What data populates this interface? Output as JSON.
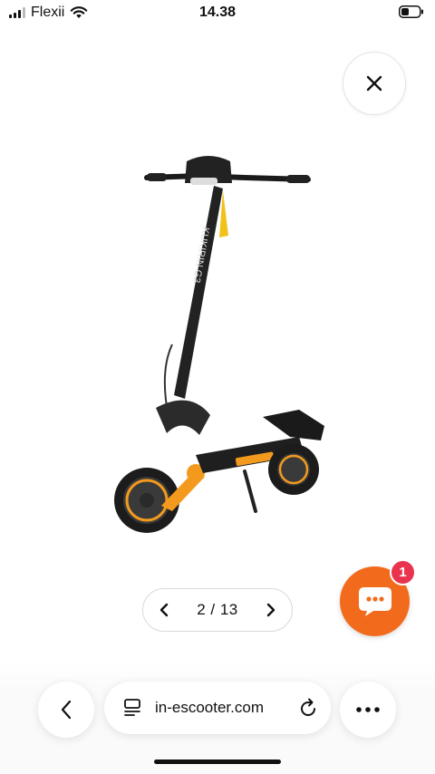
{
  "status_bar": {
    "carrier": "Flexii",
    "time": "14.38"
  },
  "gallery": {
    "current": "2",
    "total": "13",
    "pager_text": "2 / 13"
  },
  "chat": {
    "badge_count": "1"
  },
  "browser": {
    "url": "in-escooter.com"
  },
  "colors": {
    "accent_orange": "#f26b1d",
    "badge_red": "#e8344e",
    "scooter_orange": "#f39a1e"
  }
}
